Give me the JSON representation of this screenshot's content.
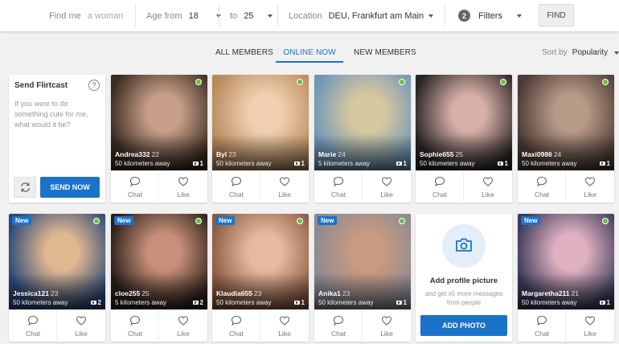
{
  "search": {
    "find_me_label": "Find me",
    "find_me_value": "a woman",
    "age_from_label": "Age from",
    "age_from_value": "18",
    "age_to_label": "to",
    "age_to_value": "25",
    "location_label": "Location",
    "location_value": "DEU, Frankfurt am Main + 5...",
    "filters_count": "2",
    "filters_label": "Filters",
    "find_button": "FIND"
  },
  "tabs": [
    {
      "label": "ALL MEMBERS"
    },
    {
      "label": "ONLINE NOW"
    },
    {
      "label": "NEW MEMBERS"
    }
  ],
  "sort": {
    "label": "Sort by",
    "value": "Popularity"
  },
  "flirtcast": {
    "title": "Send Flirtcast",
    "help": "?",
    "message": "If you were to do something cute for me, what would it be?",
    "send_button": "SEND NOW"
  },
  "actions": {
    "chat": "Chat",
    "like": "Like"
  },
  "new_badge": "New",
  "profiles": [
    {
      "name": "Andrea332",
      "age": "22",
      "distance": "50 kilometers away",
      "photos": "1",
      "color_a": "#3a2a20",
      "color_b": "#c8a089"
    },
    {
      "name": "Byl",
      "age": "23",
      "distance": "50 kilometers away",
      "photos": "1",
      "color_a": "#b88a5c",
      "color_b": "#f0d0b0"
    },
    {
      "name": "Marie",
      "age": "24",
      "distance": "5 kilometers away",
      "photos": "1",
      "color_a": "#6f97b8",
      "color_b": "#d8c8a0"
    },
    {
      "name": "Sophie655",
      "age": "25",
      "distance": "50 kilometers away",
      "photos": "1",
      "color_a": "#2a2626",
      "color_b": "#d8b0a8"
    },
    {
      "name": "Maxi0986",
      "age": "24",
      "distance": "50 kilometers away",
      "photos": "1",
      "color_a": "#4a3a34",
      "color_b": "#b89a88"
    },
    {
      "name": "Jessica121",
      "age": "23",
      "distance": "50 kilometers away",
      "photos": "2",
      "color_a": "#2a4878",
      "color_b": "#e0b890"
    },
    {
      "name": "cloe255",
      "age": "25",
      "distance": "5 kilometers away",
      "photos": "2",
      "color_a": "#2a1e18",
      "color_b": "#c8907a"
    },
    {
      "name": "Klaudia655",
      "age": "23",
      "distance": "50 kilometers away",
      "photos": "1",
      "color_a": "#8a5a40",
      "color_b": "#e8b8a0"
    },
    {
      "name": "Anika1",
      "age": "23",
      "distance": "50 kilometers away",
      "photos": "1",
      "color_a": "#8a8a94",
      "color_b": "#c89a80"
    },
    {
      "name": "Margaretha211",
      "age": "21",
      "distance": "50 kilometers away",
      "photos": "1",
      "color_a": "#3a3a58",
      "color_b": "#e0b0c0"
    }
  ],
  "add_picture": {
    "title": "Add profile picture",
    "subtitle": "and get x5 more messages from people",
    "button": "ADD PHOTO"
  }
}
